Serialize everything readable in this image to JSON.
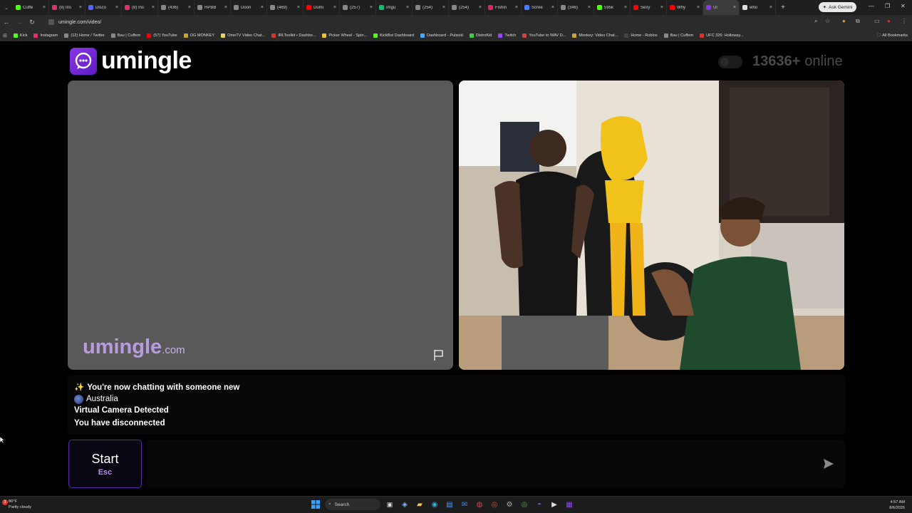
{
  "browser": {
    "tabs": [
      {
        "label": "Cuffe",
        "color": "#53fc18",
        "active": false
      },
      {
        "label": "(8) Ins",
        "color": "#e1306c",
        "active": false
      },
      {
        "label": "Disco",
        "color": "#5865f2",
        "active": false
      },
      {
        "label": "(8) Ins",
        "color": "#e1306c",
        "active": false
      },
      {
        "label": "(436)",
        "color": "#888888",
        "active": false
      },
      {
        "label": "HPBB",
        "color": "#888888",
        "active": false
      },
      {
        "label": "Doori",
        "color": "#888888",
        "active": false
      },
      {
        "label": "(469)",
        "color": "#888888",
        "active": false
      },
      {
        "label": "Dumi",
        "color": "#ff0000",
        "active": false
      },
      {
        "label": "(257)",
        "color": "#888888",
        "active": false
      },
      {
        "label": "Imgu",
        "color": "#1bb76e",
        "active": false
      },
      {
        "label": "(254)",
        "color": "#888888",
        "active": false
      },
      {
        "label": "(254)",
        "color": "#888888",
        "active": false
      },
      {
        "label": "Fishin",
        "color": "#e0245e",
        "active": false
      },
      {
        "label": "Scree",
        "color": "#4a7dff",
        "active": false
      },
      {
        "label": "(346)",
        "color": "#888888",
        "active": false
      },
      {
        "label": "595k",
        "color": "#53fc18",
        "active": false
      },
      {
        "label": "Sexy",
        "color": "#ff0000",
        "active": false
      },
      {
        "label": "Why",
        "color": "#ff0000",
        "active": false
      },
      {
        "label": "Ui",
        "color": "#8a36e6",
        "active": true
      },
      {
        "label": "who",
        "color": "#dddddd",
        "active": false
      }
    ],
    "new_tab": "+",
    "gemini_label": "Ask Gemini",
    "url": "umingle.com/video/",
    "bookmarks": [
      {
        "label": "Kick",
        "color": "#53fc18"
      },
      {
        "label": "Instagram",
        "color": "#e1306c"
      },
      {
        "label": "(12) Home / Twitter",
        "color": "#888888"
      },
      {
        "label": "Bau | Cuffem",
        "color": "#888888"
      },
      {
        "label": "(57) YouTube",
        "color": "#ff0000"
      },
      {
        "label": "OG MONKEY",
        "color": "#c9a23a"
      },
      {
        "label": "OmeTV Video Chat...",
        "color": "#e8d36a"
      },
      {
        "label": "IRLToolkit • Dashbo...",
        "color": "#d9342b"
      },
      {
        "label": "Picker Wheel - Spin...",
        "color": "#f2c02b"
      },
      {
        "label": "KickBot Dashboard",
        "color": "#53fc18"
      },
      {
        "label": "Dashboard - Pulsoid",
        "color": "#44aaff"
      },
      {
        "label": "DistroKid",
        "color": "#44cc44"
      },
      {
        "label": "Twitch",
        "color": "#9146ff"
      },
      {
        "label": "YouTube to WAV D...",
        "color": "#cc4444"
      },
      {
        "label": "Monkey: Video Chat...",
        "color": "#c9a23a"
      },
      {
        "label": "Home - Roblox",
        "color": "#444444"
      },
      {
        "label": "Bau | Cuffem",
        "color": "#888888"
      },
      {
        "label": "UFC 326: Holloway...",
        "color": "#d9342b"
      }
    ],
    "all_bookmarks": "All Bookmarks"
  },
  "header": {
    "logo_text": "umingle",
    "online_count": "13636+",
    "online_label": "online"
  },
  "video": {
    "brand_main": "umingle",
    "brand_suffix": ".com"
  },
  "chat": {
    "line1": "You're now chatting with someone new",
    "line1_icon": "✨",
    "country": "Australia",
    "line3": "Virtual Camera Detected",
    "line4": "You have disconnected"
  },
  "controls": {
    "start_label": "Start",
    "start_hint": "Esc",
    "message_placeholder": ""
  },
  "taskbar": {
    "weather_badge": "3",
    "weather_temp": "86°F",
    "weather_desc": "Partly cloudy",
    "search_label": "Search",
    "time": "4:57 AM",
    "date": "8/6/2026"
  },
  "colors": {
    "accent": "#8a36e6",
    "start_border": "#5b2aa8",
    "esc_text": "#b48ff0"
  }
}
